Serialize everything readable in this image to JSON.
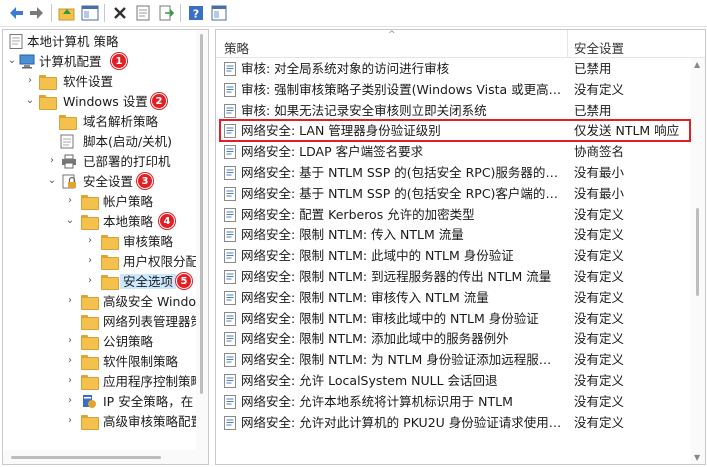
{
  "toolbar": {
    "buttons": [
      "back-icon",
      "forward-icon",
      "up-folder-icon",
      "show-hide-tree-icon",
      "delete-icon",
      "properties-icon",
      "export-icon",
      "help-icon",
      "help-panel-icon"
    ]
  },
  "tree": {
    "root": "本地计算机 策略",
    "computer_config": "计算机配置",
    "software_settings": "软件设置",
    "windows_settings": "Windows 设置",
    "name_resolution": "域名解析策略",
    "scripts": "脚本(启动/关机)",
    "printers": "已部署的打印机",
    "security_settings": "安全设置",
    "account_policies": "帐户策略",
    "local_policies": "本地策略",
    "audit_policy": "审核策略",
    "user_rights": "用户权限分配",
    "security_options": "安全选项",
    "firewall": "高级安全 Windo",
    "network_list": "网络列表管理器策",
    "public_key": "公钥策略",
    "software_restriction": "软件限制策略",
    "app_control": "应用程序控制策略",
    "ip_security": "IP 安全策略，在",
    "advanced_audit": "高级审核策略配置"
  },
  "badges": [
    "1",
    "2",
    "3",
    "4",
    "5"
  ],
  "list": {
    "header_policy": "策略",
    "header_setting": "安全设置",
    "rows": [
      {
        "name": "审核: 对全局系统对象的访问进行审核",
        "value": "已禁用"
      },
      {
        "name": "审核: 强制审核策略子类别设置(Windows Vista 或更高版本...",
        "value": "没有定义"
      },
      {
        "name": "审核: 如果无法记录安全审核则立即关闭系统",
        "value": "已禁用"
      },
      {
        "name": "网络安全: LAN 管理器身份验证级别",
        "value": "仅发送 NTLM 响应"
      },
      {
        "name": "网络安全: LDAP 客户端签名要求",
        "value": "协商签名"
      },
      {
        "name": "网络安全: 基于 NTLM SSP 的(包括安全 RPC)服务器的最小...",
        "value": "没有最小"
      },
      {
        "name": "网络安全: 基于 NTLM SSP 的(包括安全 RPC)客户端的最小...",
        "value": "没有最小"
      },
      {
        "name": "网络安全: 配置 Kerberos 允许的加密类型",
        "value": "没有定义"
      },
      {
        "name": "网络安全: 限制 NTLM: 传入 NTLM 流量",
        "value": "没有定义"
      },
      {
        "name": "网络安全: 限制 NTLM: 此域中的 NTLM 身份验证",
        "value": "没有定义"
      },
      {
        "name": "网络安全: 限制 NTLM: 到远程服务器的传出 NTLM 流量",
        "value": "没有定义"
      },
      {
        "name": "网络安全: 限制 NTLM: 审核传入 NTLM 流量",
        "value": "没有定义"
      },
      {
        "name": "网络安全: 限制 NTLM: 审核此域中的 NTLM 身份验证",
        "value": "没有定义"
      },
      {
        "name": "网络安全: 限制 NTLM: 添加此域中的服务器例外",
        "value": "没有定义"
      },
      {
        "name": "网络安全: 限制 NTLM: 为 NTLM 身份验证添加远程服务器...",
        "value": "没有定义"
      },
      {
        "name": "网络安全: 允许 LocalSystem NULL 会话回退",
        "value": "没有定义"
      },
      {
        "name": "网络安全: 允许本地系统将计算机标识用于 NTLM",
        "value": "没有定义"
      },
      {
        "name": "网络安全: 允许对此计算机的 PKU2U 身份验证请求使用联...",
        "value": "没有定义"
      }
    ]
  },
  "colors": {
    "accent_red": "#e31e24",
    "selection": "#cce8ff"
  }
}
